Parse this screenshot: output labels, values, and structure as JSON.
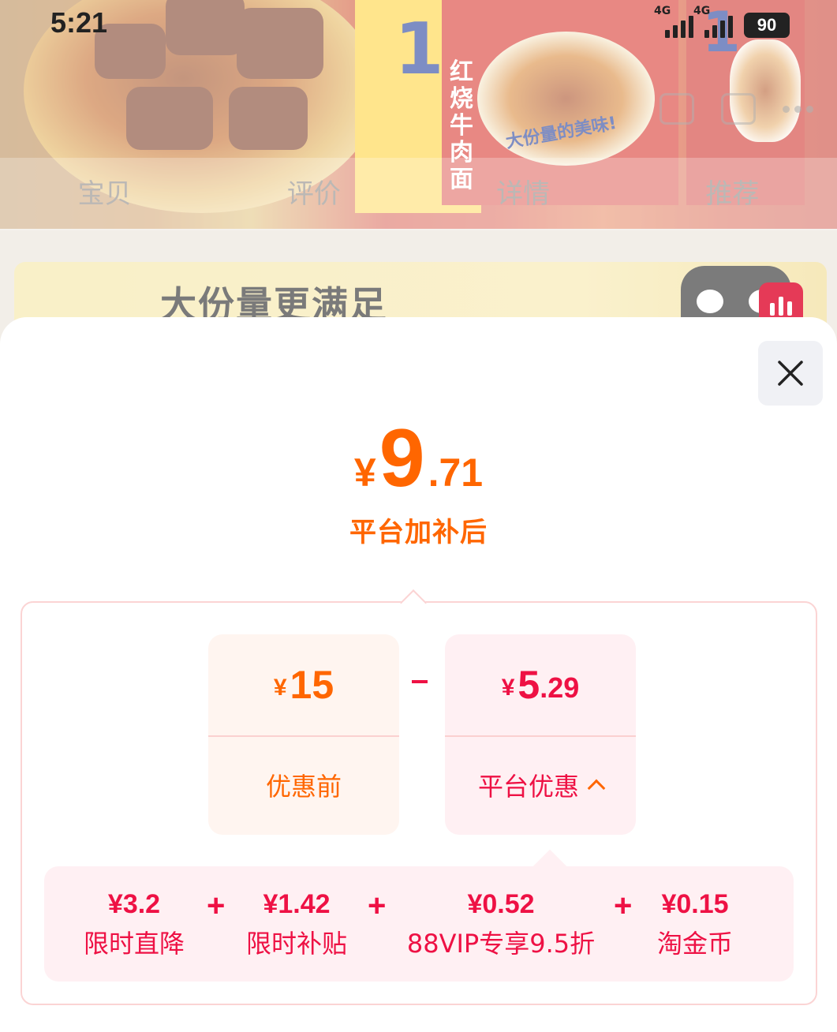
{
  "status_bar": {
    "time": "5:21",
    "network_1": "4G",
    "network_2": "4G",
    "battery": "90"
  },
  "product_tabs": [
    "宝贝",
    "评价",
    "详情",
    "推荐"
  ],
  "promo_banner": {
    "text": "大份量更满足"
  },
  "package": {
    "flavor_text": "红烧牛肉面",
    "slogan": "大份量的美味!"
  },
  "price_sheet": {
    "final_price": {
      "currency": "¥",
      "integer": "9",
      "decimal": ".71"
    },
    "final_label": "平台加补后",
    "before": {
      "currency": "¥",
      "amount": "15",
      "label": "优惠前"
    },
    "operator": "-",
    "discount": {
      "currency": "¥",
      "integer": "5",
      "decimal": ".29",
      "label": "平台优惠"
    },
    "discount_items": [
      {
        "value": "¥3.2",
        "label": "限时直降"
      },
      {
        "value": "¥1.42",
        "label": "限时补贴"
      },
      {
        "value": "¥0.52",
        "label": "88VIP专享9.5折"
      },
      {
        "value": "¥0.15",
        "label": "淘金币"
      }
    ],
    "plus_sign": "+"
  },
  "colors": {
    "price_orange": "#ff6600",
    "discount_red": "#ee1144",
    "panel_border": "#fbd4d4"
  },
  "icons": [
    "close-icon",
    "chevron-up-icon",
    "bar-chart-icon",
    "cart-icon",
    "share-icon",
    "more-icon"
  ]
}
